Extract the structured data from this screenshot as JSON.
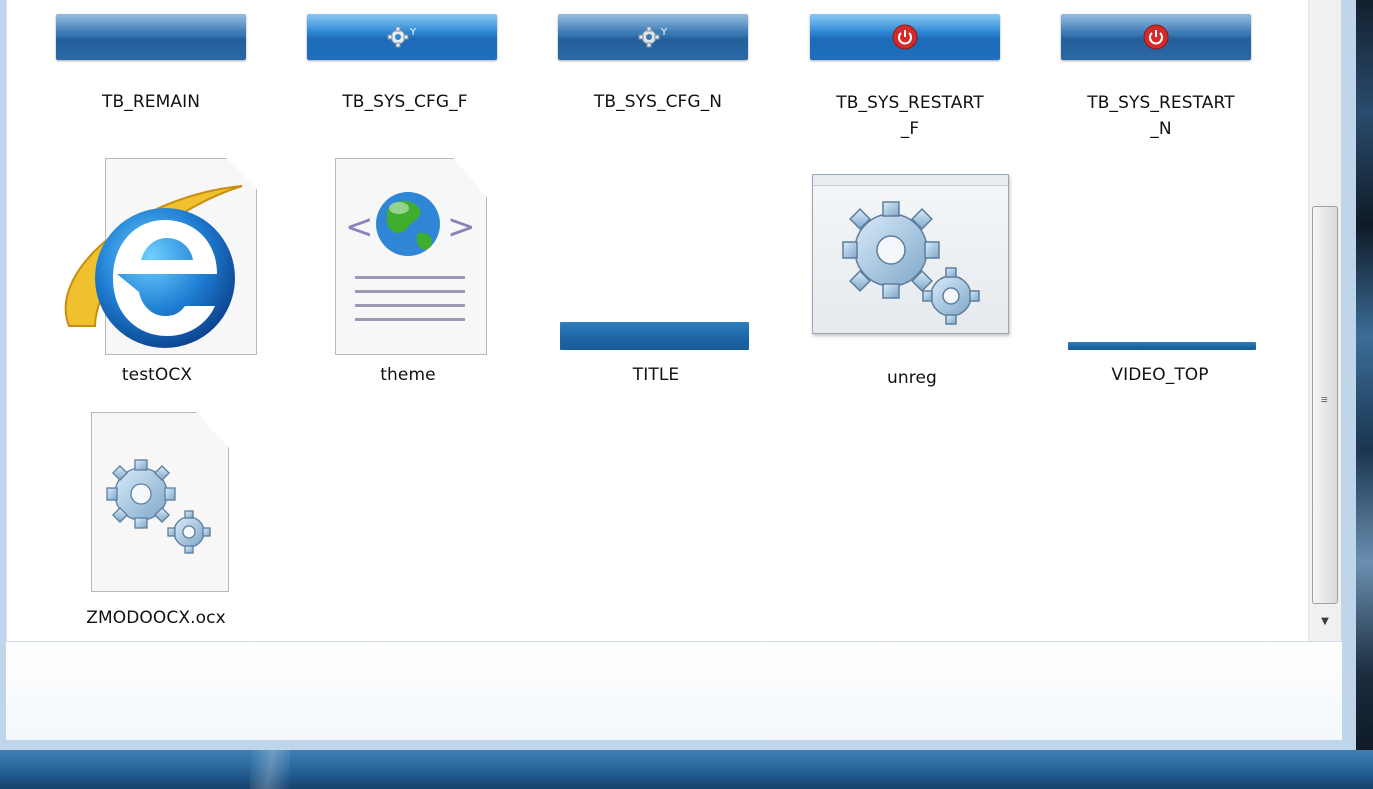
{
  "items": [
    {
      "label": "TB_REMAIN",
      "icon": "blue-bar-icon"
    },
    {
      "label": "TB_SYS_CFG_F",
      "icon": "gear-bar-icon"
    },
    {
      "label": "TB_SYS_CFG_N",
      "icon": "gear-bar-icon"
    },
    {
      "label": "TB_SYS_RESTART\n_F",
      "icon": "power-bar-icon"
    },
    {
      "label": "TB_SYS_RESTART\n_N",
      "icon": "power-bar-icon"
    },
    {
      "label": "testOCX",
      "icon": "internet-explorer-document-icon"
    },
    {
      "label": "theme",
      "icon": "html-globe-document-icon"
    },
    {
      "label": "TITLE",
      "icon": "title-bar-image-icon"
    },
    {
      "label": "unreg",
      "icon": "application-gears-icon"
    },
    {
      "label": "VIDEO_TOP",
      "icon": "thin-bar-image-icon"
    },
    {
      "label": "ZMODOOCX.ocx",
      "icon": "system-file-gears-icon"
    }
  ],
  "colors": {
    "window_bg": "#bfd6ea",
    "button_blue": "#2d86d2",
    "power_red": "#d42a2a",
    "taskbar": "#2d6da2"
  }
}
